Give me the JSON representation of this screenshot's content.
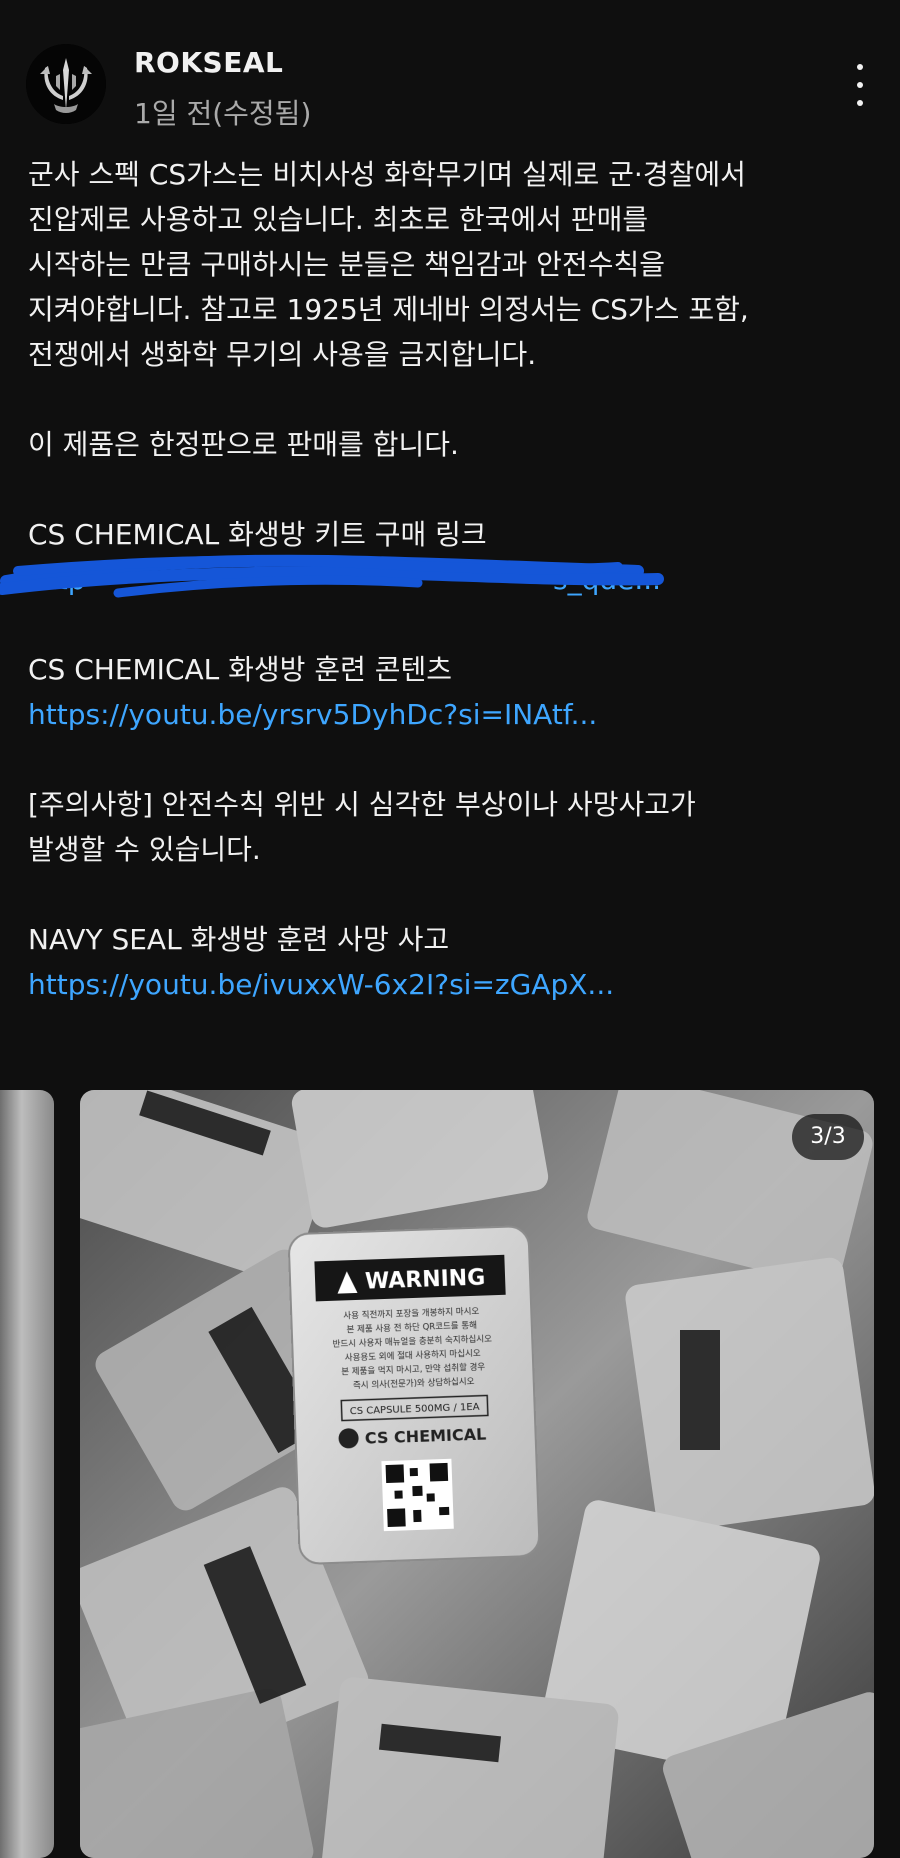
{
  "post": {
    "channel_name": "ROKSEAL",
    "timestamp": "1일 전(수정됨)",
    "paragraph1": [
      "군사 스펙 CS가스는 비치사성 화학무기며 실제로 군·경찰에서",
      "진압제로 사용하고 있습니다. 최초로 한국에서 판매를",
      "시작하는 만큼 구매하시는 분들은 책임감과 안전수칙을",
      "지켜야합니다. 참고로 1925년 제네바 의정서는 CS가스 포함,",
      "전쟁에서 생화학 무기의 사용을 금지합니다."
    ],
    "paragraph2": "이 제품은 한정판으로 판매를 합니다.",
    "kit_title": "CS CHEMICAL 화생방 키트 구매 링크",
    "kit_link_visible_start": "http",
    "kit_link_visible_end": "s_qde...",
    "training_title": "CS CHEMICAL 화생방 훈련 콘텐츠",
    "training_link": "https://youtu.be/yrsrv5DyhDc?si=INAtf...",
    "warning_line1": "[주의사항] 안전수칙 위반 시 심각한 부상이나 사망사고가",
    "warning_line2": "발생할 수 있습니다.",
    "accident_title": "NAVY SEAL 화생방 훈련 사망 사고",
    "accident_link": "https://youtu.be/ivuxxW-6x2I?si=zGApX..."
  },
  "carousel": {
    "counter": "3/3",
    "packet": {
      "warning": "WARNING",
      "lines": [
        "사용 직전까지 포장을 개봉하지 마시오",
        "본 제품 사용 전 하단 QR코드를 통해",
        "반드시 사용자 매뉴얼을 충분히 숙지하십시오",
        "사용용도 외에 절대 사용하지 마십시오",
        "본 제품을 먹지 마시고, 만약 섭취할 경우",
        "즉시 의사(전문가)와 상담하십시오"
      ],
      "capsule": "CS CAPSULE 500MG / 1EA",
      "brand": "CS CHEMICAL"
    }
  },
  "icons": {
    "more": "more-vertical-icon",
    "avatar": "trident-logo"
  },
  "colors": {
    "background": "#0f0f0f",
    "text": "#f1f1f1",
    "secondary": "#aaaaaa",
    "link": "#3ea6ff",
    "scribble": "#1556d8"
  }
}
